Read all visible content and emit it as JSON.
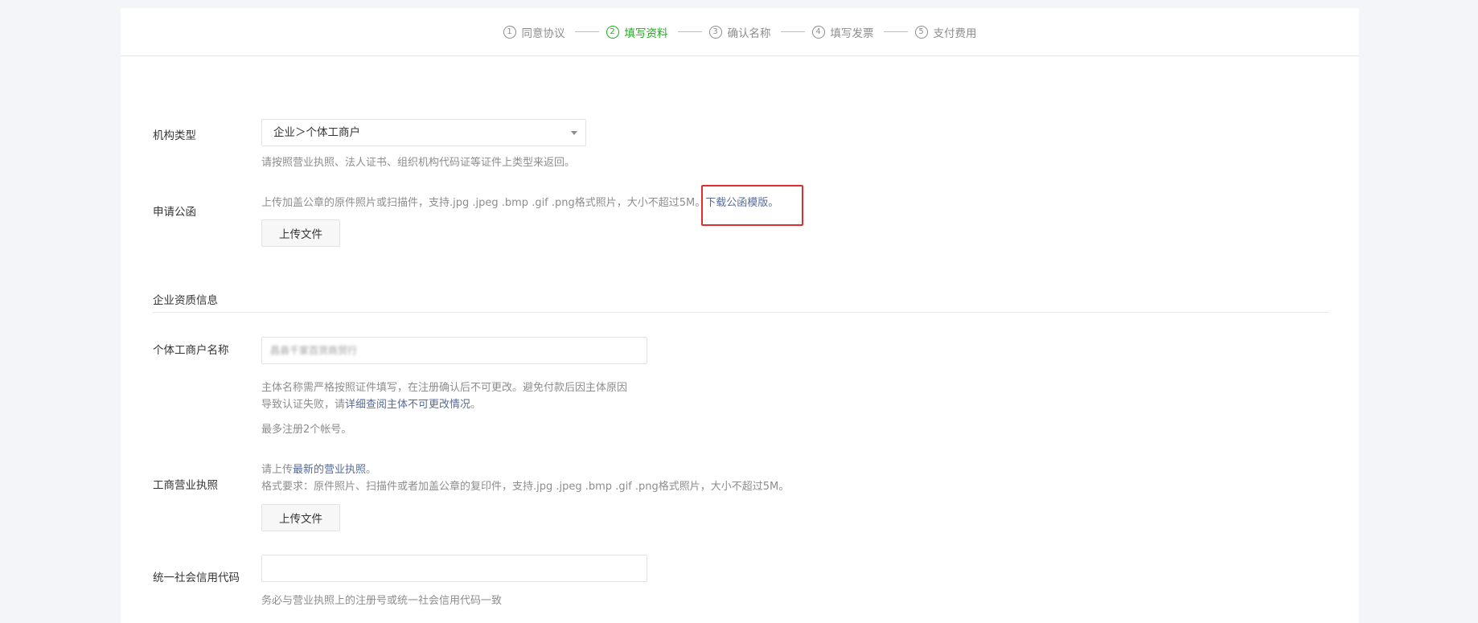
{
  "steps": [
    {
      "num": "1",
      "label": "同意协议"
    },
    {
      "num": "2",
      "label": "填写资料"
    },
    {
      "num": "3",
      "label": "确认名称"
    },
    {
      "num": "4",
      "label": "填写发票"
    },
    {
      "num": "5",
      "label": "支付费用"
    }
  ],
  "org_type": {
    "label": "机构类型",
    "value": "企业＞个体工商户",
    "tip": "请按照营业执照、法人证书、组织机构代码证等证件上类型来返回。"
  },
  "application_letter": {
    "label": "申请公函",
    "tip": "上传加盖公章的原件照片或扫描件，支持.jpg .jpeg .bmp .gif .png格式照片，大小不超过5M。",
    "download_link": "下载公函模版。",
    "upload_label": "上传文件"
  },
  "section_title": "企业资质信息",
  "merchant_name": {
    "label": "个体工商户名称",
    "value": "昌县千家百货商贸行",
    "tip_line1": "主体名称需严格按照证件填写，在注册确认后不可更改。避免付款后因主体原因",
    "tip_line2_prefix": "导致认证失败，请",
    "tip_line2_link": "详细查阅主体不可更改情况",
    "tip_line2_suffix": "。",
    "tip_limit": "最多注册2个帐号。"
  },
  "business_license": {
    "label": "工商营业执照",
    "tip_prefix": "请上传",
    "tip_link": "最新的营业执照",
    "tip_suffix": "。",
    "tip_format": "格式要求：原件照片、扫描件或者加盖公章的复印件，支持.jpg .jpeg .bmp .gif .png格式照片，大小不超过5M。",
    "upload_label": "上传文件"
  },
  "credit_code": {
    "label": "统一社会信用代码",
    "placeholder": "",
    "tip": "务必与营业执照上的注册号或统一社会信用代码一致"
  },
  "colors": {
    "accent": "#1aad19",
    "link": "#576b95",
    "highlight": "#e02e2e"
  }
}
